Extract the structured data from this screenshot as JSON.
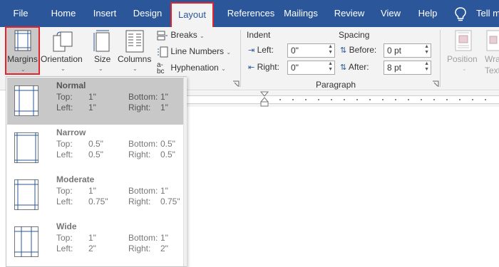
{
  "tabs": [
    {
      "label": "File",
      "active": false
    },
    {
      "label": "Home",
      "active": false
    },
    {
      "label": "Insert",
      "active": false
    },
    {
      "label": "Design",
      "active": false
    },
    {
      "label": "Layout",
      "active": true
    },
    {
      "label": "References",
      "active": false
    },
    {
      "label": "Mailings",
      "active": false
    },
    {
      "label": "Review",
      "active": false
    },
    {
      "label": "View",
      "active": false
    },
    {
      "label": "Help",
      "active": false
    }
  ],
  "tell_me": "Tell m",
  "colors": {
    "accent": "#2b579a",
    "highlight": "#e0232d",
    "ribbon": "#f3f3f3",
    "selected": "#c8c8c8"
  },
  "page_setup": {
    "margins": "Margins",
    "orientation": "Orientation",
    "size": "Size",
    "columns": "Columns",
    "breaks": "Breaks",
    "line_numbers": "Line Numbers",
    "hyphenation": "Hyphenation"
  },
  "paragraph": {
    "title": "Paragraph",
    "indent_label": "Indent",
    "left_label": "Left:",
    "left_value": "0\"",
    "right_label": "Right:",
    "right_value": "0\"",
    "spacing_label": "Spacing",
    "before_label": "Before:",
    "before_value": "0 pt",
    "after_label": "After:",
    "after_value": "8 pt"
  },
  "arrange": {
    "position": "Position",
    "wrap": "Wra",
    "wrap2": "Text"
  },
  "margin_presets": [
    {
      "name": "Normal",
      "top_label": "Top:",
      "top": "1\"",
      "bottom_label": "Bottom:",
      "bottom": "1\"",
      "left_label": "Left:",
      "left": "1\"",
      "right_label": "Right:",
      "right": "1\""
    },
    {
      "name": "Narrow",
      "top_label": "Top:",
      "top": "0.5\"",
      "bottom_label": "Bottom:",
      "bottom": "0.5\"",
      "left_label": "Left:",
      "left": "0.5\"",
      "right_label": "Right:",
      "right": "0.5\""
    },
    {
      "name": "Moderate",
      "top_label": "Top:",
      "top": "1\"",
      "bottom_label": "Bottom:",
      "bottom": "1\"",
      "left_label": "Left:",
      "left": "0.75\"",
      "right_label": "Right:",
      "right": "0.75\""
    },
    {
      "name": "Wide",
      "top_label": "Top:",
      "top": "1\"",
      "bottom_label": "Bottom:",
      "bottom": "1\"",
      "left_label": "Left:",
      "left": "2\"",
      "right_label": "Right:",
      "right": "2\""
    }
  ]
}
